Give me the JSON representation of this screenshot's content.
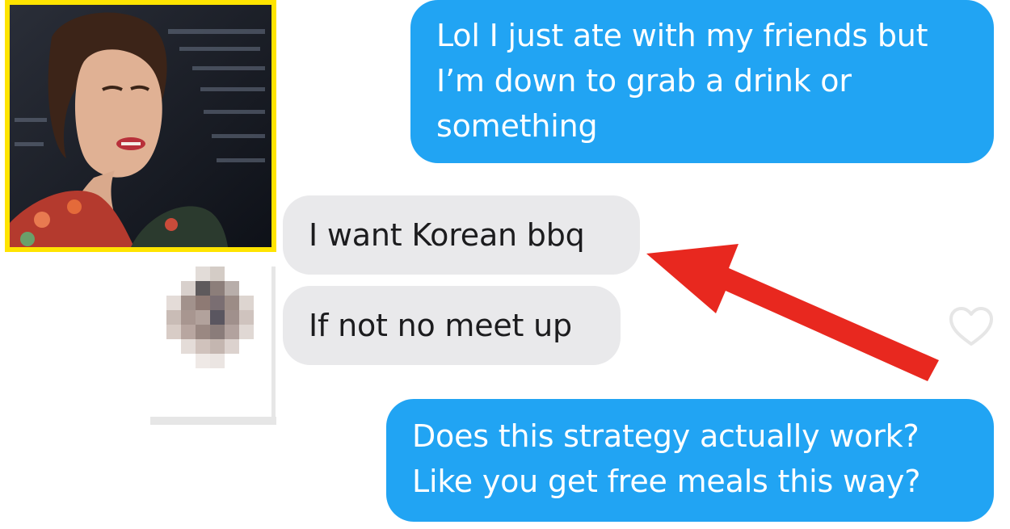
{
  "conversation": {
    "messages": [
      {
        "direction": "outgoing",
        "text": "Lol I just ate with my friends but\nI’m down to grab a drink or\nsomething"
      },
      {
        "direction": "incoming",
        "text": "I want Korean bbq"
      },
      {
        "direction": "incoming",
        "text": "If not no meet up"
      },
      {
        "direction": "outgoing",
        "text": "Does this strategy actually work?\nLike you get free meals this way?"
      }
    ]
  },
  "icons": {
    "like": "heart-outline-icon",
    "annotation": "red-arrow-icon",
    "avatar": "pixelated-avatar"
  },
  "colors": {
    "outgoing_bubble": "#21a4f3",
    "incoming_bubble": "#e9e9eb",
    "photo_border": "#ffe400",
    "arrow": "#e8281f"
  }
}
